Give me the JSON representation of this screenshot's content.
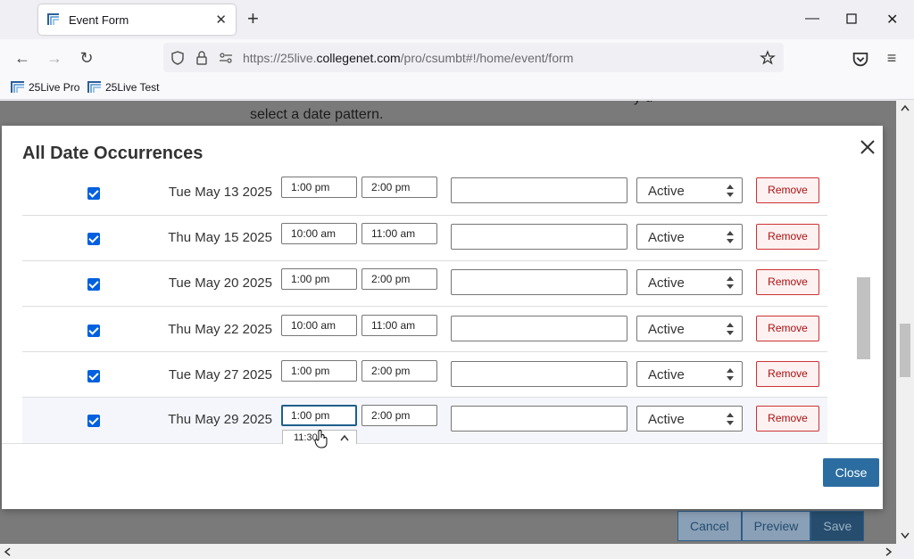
{
  "browser": {
    "tab_title": "Event Form",
    "url_prefix": "https://25live.",
    "url_domain": "collegenet.com",
    "url_path": "/pro/csumbt#!/home/event/form",
    "bookmarks": [
      "25Live Pro",
      "25Live Test"
    ]
  },
  "page": {
    "text_line": "select a date pattern.",
    "text_partial": "y d",
    "buttons": {
      "cancel": "Cancel",
      "preview": "Preview",
      "save": "Save"
    }
  },
  "modal": {
    "title": "All Date Occurrences",
    "close_label": "Close",
    "rows": [
      {
        "date": "Tue May 13 2025",
        "start": "1:00 pm",
        "end": "2:00 pm",
        "status": "Active",
        "remove": "Remove"
      },
      {
        "date": "Thu May 15 2025",
        "start": "10:00 am",
        "end": "11:00 am",
        "status": "Active",
        "remove": "Remove"
      },
      {
        "date": "Tue May 20 2025",
        "start": "1:00 pm",
        "end": "2:00 pm",
        "status": "Active",
        "remove": "Remove"
      },
      {
        "date": "Thu May 22 2025",
        "start": "10:00 am",
        "end": "11:00 am",
        "status": "Active",
        "remove": "Remove"
      },
      {
        "date": "Tue May 27 2025",
        "start": "1:00 pm",
        "end": "2:00 pm",
        "status": "Active",
        "remove": "Remove"
      },
      {
        "date": "Thu May 29 2025",
        "start": "1:00 pm",
        "end": "2:00 pm",
        "status": "Active",
        "remove": "Remove"
      }
    ],
    "dropdown_option": "11:30"
  },
  "colors": {
    "accent": "#2b6da0",
    "checkbox": "#0060df",
    "remove": "#cc3333"
  }
}
